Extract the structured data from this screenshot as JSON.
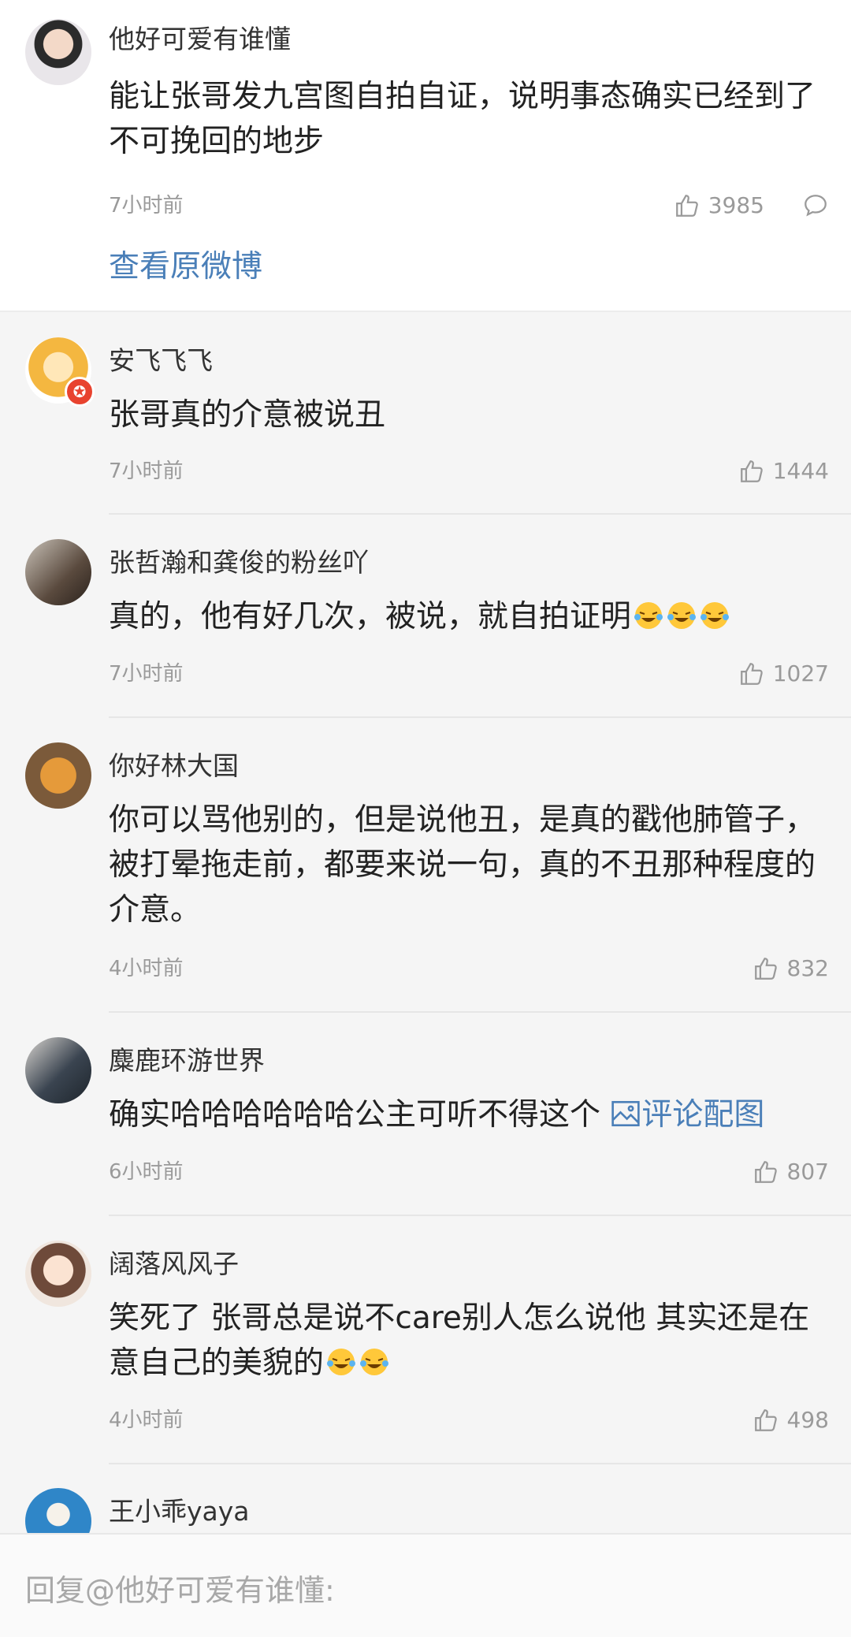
{
  "original_post": {
    "username": "他好可爱有谁懂",
    "text": "能让张哥发九宫图自拍自证，说明事态确实已经到了不可挽回的地步",
    "time": "7小时前",
    "likes": "3985",
    "view_original": "查看原微博"
  },
  "comments": [
    {
      "username": "安飞飞飞",
      "text": "张哥真的介意被说丑",
      "time": "7小时前",
      "likes": "1444"
    },
    {
      "username": "张哲瀚和龚俊的粉丝吖",
      "text": "真的，他有好几次，被说，就自拍证明",
      "emoji_count": 3,
      "time": "7小时前",
      "likes": "1027"
    },
    {
      "username": "你好林大国",
      "text": "你可以骂他别的，但是说他丑，是真的戳他肺管子，被打晕拖走前，都要来说一句，真的不丑那种程度的介意。",
      "time": "4小时前",
      "likes": "832"
    },
    {
      "username": "麋鹿环游世界",
      "text": "确实哈哈哈哈哈哈公主可听不得这个 ",
      "pic_label": "评论配图",
      "time": "6小时前",
      "likes": "807"
    },
    {
      "username": "阔落风风子",
      "text": "笑死了 张哥总是说不care别人怎么说他 其实还是在意自己的美貌的",
      "emoji_count": 2,
      "time": "4小时前",
      "likes": "498"
    },
    {
      "username": "王小乖yaya"
    }
  ],
  "reply_placeholder": "回复@他好可爱有谁懂:",
  "colors": {
    "link": "#4a7fb8",
    "meta": "#9a9a9a",
    "text": "#222222",
    "badge": "#e8432f"
  },
  "icons": [
    "thumbs-up-icon",
    "comment-bubble-icon",
    "laughing-tears-emoji",
    "image-icon",
    "vip-badge-icon"
  ]
}
